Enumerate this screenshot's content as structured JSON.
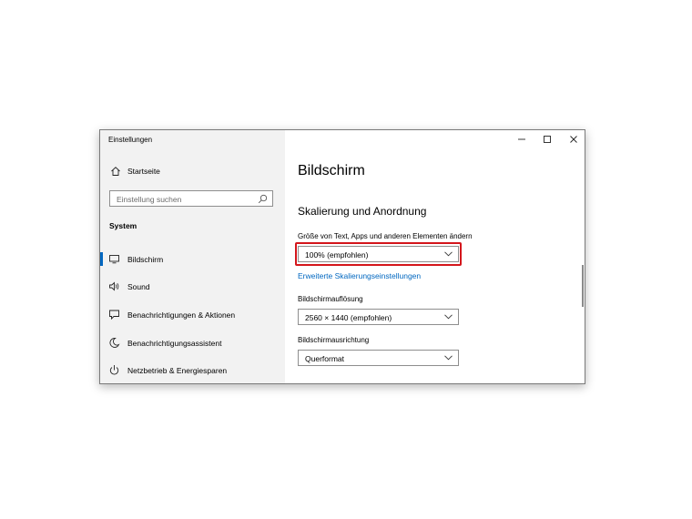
{
  "window": {
    "title": "Einstellungen",
    "controls": [
      "minimize",
      "maximize",
      "close"
    ]
  },
  "sidebar": {
    "home_label": "Startseite",
    "home_icon": "home-icon",
    "search_placeholder": "Einstellung suchen",
    "section_title": "System",
    "items": [
      {
        "label": "Bildschirm",
        "icon": "monitor-icon",
        "selected": true
      },
      {
        "label": "Sound",
        "icon": "speaker-icon",
        "selected": false
      },
      {
        "label": "Benachrichtigungen & Aktionen",
        "icon": "message-icon",
        "selected": false
      },
      {
        "label": "Benachrichtigungsassistent",
        "icon": "moon-icon",
        "selected": false
      },
      {
        "label": "Netzbetrieb & Energiesparen",
        "icon": "power-icon",
        "selected": false
      }
    ]
  },
  "main": {
    "page_title": "Bildschirm",
    "section_title": "Skalierung und Anordnung",
    "scale": {
      "label": "Größe von Text, Apps und anderen Elementen ändern",
      "value": "100% (empfohlen)"
    },
    "advanced_link": "Erweiterte Skalierungseinstellungen",
    "resolution": {
      "label": "Bildschirmauflösung",
      "value": "2560 × 1440 (empfohlen)"
    },
    "orientation": {
      "label": "Bildschirmausrichtung",
      "value": "Querformat"
    }
  },
  "colors": {
    "accent": "#0067c0",
    "highlight": "#d4161c",
    "sidebar_bg": "#f2f2f2"
  }
}
